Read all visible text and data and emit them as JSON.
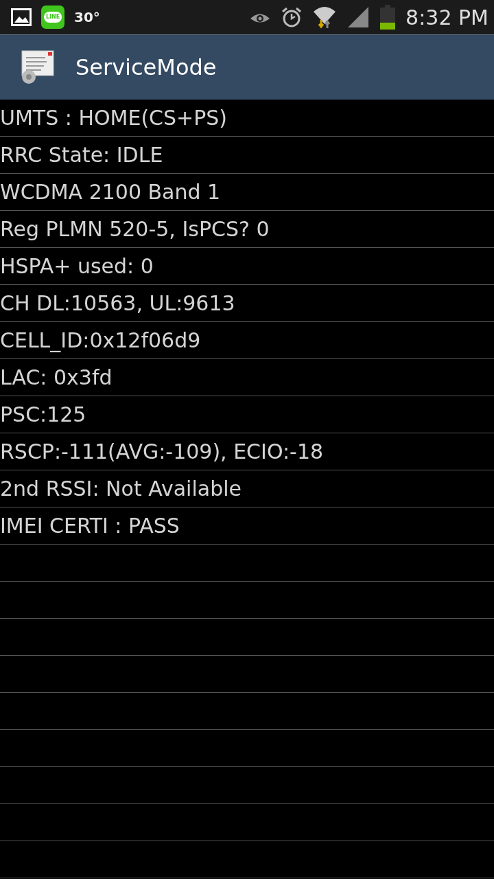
{
  "status_bar": {
    "app_badge": "LINE",
    "temperature": "30°",
    "time": "8:32 PM"
  },
  "app_bar": {
    "title": "ServiceMode"
  },
  "rows": [
    "UMTS : HOME(CS+PS)",
    "RRC State: IDLE",
    "WCDMA 2100 Band 1",
    "Reg PLMN 520-5, IsPCS? 0",
    "HSPA+ used: 0",
    "CH DL:10563, UL:9613",
    "CELL_ID:0x12f06d9",
    "LAC: 0x3fd",
    "PSC:125",
    "RSCP:-111(AVG:-109), ECIO:-18",
    "2nd RSSI: Not Available",
    "IMEI CERTI : PASS"
  ]
}
